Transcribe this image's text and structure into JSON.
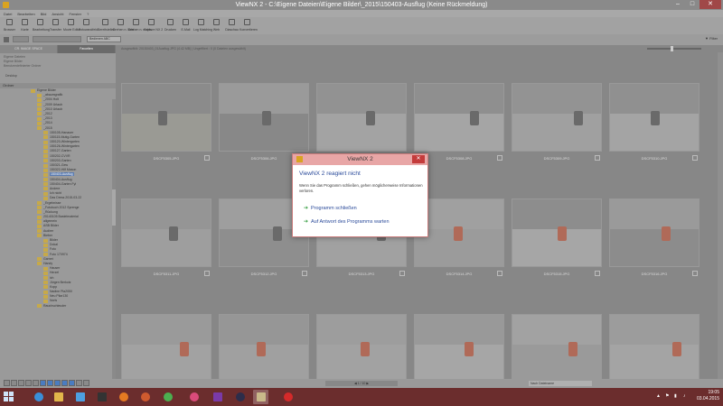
{
  "window": {
    "title": "ViewNX 2 - C:\\Eigene Dateien\\Eigene Bilder\\_2015\\150403-Ausflug (Keine Rückmeldung)",
    "controls": {
      "minimize": "–",
      "maximize": "□",
      "close": "✕"
    }
  },
  "menu": [
    "Datei",
    "Bearbeiten",
    "Bild",
    "Ansicht",
    "Fenster",
    "?"
  ],
  "toolbar": [
    {
      "label": "Browser",
      "icon": "browser-icon"
    },
    {
      "label": "Karte",
      "icon": "map-icon"
    },
    {
      "label": "Bearbeitung",
      "icon": "edit-icon"
    },
    {
      "label": "Transfer",
      "icon": "transfer-icon"
    },
    {
      "label": "Movie Editor",
      "icon": "movie-icon"
    },
    {
      "label": "Fotowandfeld",
      "icon": "photowall-icon"
    },
    {
      "label": "Bereitstellen",
      "icon": "share-icon"
    },
    {
      "label": "Drehen n. links",
      "icon": "rotate-left-icon"
    },
    {
      "label": "Drehen n. rechts",
      "icon": "rotate-right-icon"
    },
    {
      "label": "Capture NX 2",
      "icon": "capture-icon"
    },
    {
      "label": "Drucken",
      "icon": "print-icon"
    },
    {
      "label": "E-Mail",
      "icon": "mail-icon"
    },
    {
      "label": "Log Matching",
      "icon": "log-icon"
    },
    {
      "label": "Web",
      "icon": "web-icon"
    },
    {
      "label": "Diaschau",
      "icon": "slideshow-icon"
    },
    {
      "label": "Konvertieren",
      "icon": "convert-icon"
    }
  ],
  "bar2": {
    "select_label": "Bedienen ABC",
    "filter": "Filter"
  },
  "left_panel": {
    "tabs": [
      "CR. IMAGE SPACE",
      "Favoriten"
    ],
    "favorites": [
      "Eigene Dateien",
      "Eigene Bilder",
      "Benutzerdefinierter Ordner"
    ],
    "desktop": "Desktop",
    "ordner_label": "Ordner",
    "tree": [
      {
        "label": "Eigene Bilder",
        "depth": 0
      },
      {
        "label": "_abaumgrafik",
        "depth": 1
      },
      {
        "label": "_2004 Holt",
        "depth": 1
      },
      {
        "label": "_2009 Urlaub",
        "depth": 1
      },
      {
        "label": "_2010 Urlaub",
        "depth": 1
      },
      {
        "label": "_2012",
        "depth": 1
      },
      {
        "label": "_2013",
        "depth": 1
      },
      {
        "label": "_2014",
        "depth": 1
      },
      {
        "label": "_2015",
        "depth": 1
      },
      {
        "label": "150105-Hanauer",
        "depth": 2
      },
      {
        "label": "150115-Mutig-Garten",
        "depth": 2
      },
      {
        "label": "150120-Wintergarten",
        "depth": 2
      },
      {
        "label": "150126-Wintergarten",
        "depth": 2
      },
      {
        "label": "150127-Garten",
        "depth": 2
      },
      {
        "label": "150202-CVVR",
        "depth": 2
      },
      {
        "label": "150203-Garten",
        "depth": 2
      },
      {
        "label": "150321-Gew",
        "depth": 2
      },
      {
        "label": "150322-Hilf Mason",
        "depth": 2
      },
      {
        "label": "150403-Ausflug",
        "depth": 2,
        "selected": true
      },
      {
        "label": "150404-Ausflug",
        "depth": 2
      },
      {
        "label": "150404-Garten Fyl",
        "depth": 2
      },
      {
        "label": "Andere",
        "depth": 2
      },
      {
        "label": "Ich nicht",
        "depth": 2
      },
      {
        "label": "Das Dress 2015-03-22",
        "depth": 2
      },
      {
        "label": "_Ergebnisse",
        "depth": 1
      },
      {
        "label": "_Fotobuch 2012 Sprenge",
        "depth": 1
      },
      {
        "label": "_Rückung",
        "depth": 1
      },
      {
        "label": "20140105 Bastelmaterial",
        "depth": 1
      },
      {
        "label": "allgemein",
        "depth": 1
      },
      {
        "label": "ASB Bilder",
        "depth": 1
      },
      {
        "label": "Audirer",
        "depth": 1
      },
      {
        "label": "Bieber",
        "depth": 1
      },
      {
        "label": "Bilder",
        "depth": 2
      },
      {
        "label": "Dokal",
        "depth": 2
      },
      {
        "label": "Foto",
        "depth": 2
      },
      {
        "label": "Foto 170974",
        "depth": 2
      },
      {
        "label": "Garnet",
        "depth": 1
      },
      {
        "label": "Handy",
        "depth": 1
      },
      {
        "label": "Hauser",
        "depth": 2
      },
      {
        "label": "Herzel",
        "depth": 2
      },
      {
        "label": "ich",
        "depth": 2
      },
      {
        "label": "Jürgen Berkotz",
        "depth": 2
      },
      {
        "label": "Kopp",
        "depth": 2
      },
      {
        "label": "Nadine Pla2050",
        "depth": 2
      },
      {
        "label": "Neu Pilar130",
        "depth": 2
      },
      {
        "label": "Noris",
        "depth": 2
      },
      {
        "label": "Rauchschleuder",
        "depth": 1
      }
    ]
  },
  "main": {
    "status_text": "Ausgewählt: 20150403_01Ausflug.JPG (4.42 MB) | Ungefiltert : 0 (0 Dateien ausgewählt)",
    "thumbnails": [
      {
        "name": "DSCF5305.JPG",
        "sky": "#8b8b8b",
        "ground": "#9a9a94"
      },
      {
        "name": "DSCF5306.JPG",
        "sky": "#9a9a9a",
        "ground": "#888888"
      },
      {
        "name": "DSCF5307.JPG",
        "sky": "#929292",
        "ground": "#a3a3a3"
      },
      {
        "name": "DSCF5308.JPG",
        "sky": "#8f8f8f",
        "ground": "#a5a5a5"
      },
      {
        "name": "DSCF5309.JPG",
        "sky": "#939393",
        "ground": "#a0a0a0"
      },
      {
        "name": "DSCF5310.JPG",
        "sky": "#909090",
        "ground": "#a4a4a4"
      },
      {
        "name": "DSCF5311.JPG",
        "sky": "#959595",
        "ground": "#9e9e9e"
      },
      {
        "name": "DSCF5312.JPG",
        "sky": "#9e9e9e",
        "ground": "#8e8e8e"
      },
      {
        "name": "DSCF5313.JPG",
        "sky": "#979797",
        "ground": "#a1a1a1"
      },
      {
        "name": "DSCF5314.JPG",
        "sky": "#a0a0a0",
        "ground": "#9b9b9b"
      },
      {
        "name": "DSCF5315.JPG",
        "sky": "#8d8d8d",
        "ground": "#a6a6a6"
      },
      {
        "name": "DSCF5316.JPG",
        "sky": "#9a9a9a",
        "ground": "#8c8c8c"
      },
      {
        "name": "",
        "sky": "#9a9a9a",
        "ground": "#a2a2a2"
      },
      {
        "name": "",
        "sky": "#969696",
        "ground": "#a0a0a0"
      },
      {
        "name": "",
        "sky": "#9d9d9d",
        "ground": "#a2a2a2"
      },
      {
        "name": "",
        "sky": "#999999",
        "ground": "#a6a6a6"
      },
      {
        "name": "",
        "sky": "#a2a2a2",
        "ground": "#9a9a9a"
      },
      {
        "name": "",
        "sky": "#9c9c9c",
        "ground": "#a4a4a4"
      }
    ]
  },
  "bottom": {
    "pager": "◀   1 / 10   ▶",
    "select": "Nach Dateiname"
  },
  "dialog": {
    "title": "ViewNX 2",
    "close": "✕",
    "heading": "ViewNX 2 reagiert nicht",
    "body": "Wenn Sie das Programm schließen, gehen möglicherweise Informationen verloren.",
    "options": [
      "Programm schließen",
      "Auf Antwort des Programms warten"
    ],
    "arrow": "➔"
  },
  "taskbar": {
    "time": "19:05",
    "date": "03.04.2015",
    "tray": [
      "▲",
      "⚑",
      "▮",
      "♪"
    ]
  }
}
